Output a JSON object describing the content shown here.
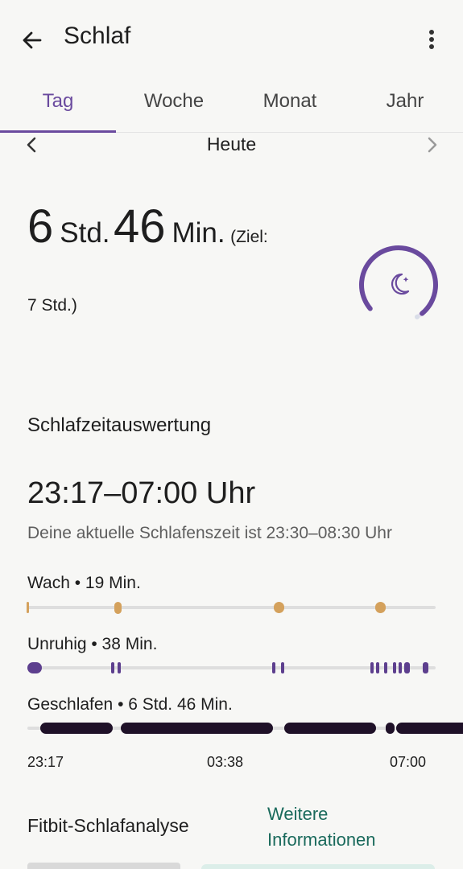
{
  "appbar": {
    "title": "Schlaf"
  },
  "tabs": [
    {
      "label": "Tag",
      "active": true
    },
    {
      "label": "Woche",
      "active": false
    },
    {
      "label": "Monat",
      "active": false
    },
    {
      "label": "Jahr",
      "active": false
    }
  ],
  "date_nav": {
    "label": "Heute"
  },
  "summary": {
    "hours_value": "6",
    "hours_unit": "Std.",
    "minutes_value": "46",
    "minutes_unit": "Min.",
    "goal_prefix": "(Ziel:",
    "goal_suffix": "7 Std.)",
    "goal_progress": 0.967
  },
  "schedule": {
    "title": "Schlafzeitauswertung",
    "range": "23:17–07:00 Uhr",
    "subtitle": "Deine aktuelle Schlafenszeit ist 23:30–08:30 Uhr"
  },
  "stages": [
    {
      "label": "Wach • 19 Min.",
      "color": "#d4a15c"
    },
    {
      "label": "Unruhig • 38 Min.",
      "color": "#5d3f8e"
    },
    {
      "label": "Geschlafen • 6 Std. 46 Min.",
      "color": "#1f1128"
    }
  ],
  "time_axis": [
    "23:17",
    "03:38",
    "07:00"
  ],
  "analysis": {
    "title": "Fitbit-Schlafanalyse",
    "link": "Weitere Informationen"
  },
  "colors": {
    "accent": "#6a4a9e",
    "link": "#1a6a5c",
    "awake": "#d4a15c",
    "restless": "#5d3f8e",
    "asleep": "#1f1128"
  }
}
